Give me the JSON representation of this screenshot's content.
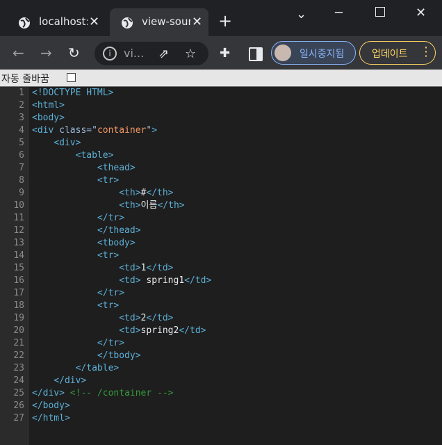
{
  "tabs": [
    {
      "title": "localhost:",
      "active": false
    },
    {
      "title": "view-sour",
      "active": true
    }
  ],
  "toolbar": {
    "url": "vi...",
    "profile_label": "일시중지됨",
    "update_label": "업데이트"
  },
  "wrap": {
    "label": "자동 줄바꿈",
    "checked": false
  },
  "colors": {
    "tag": "#5db0d7",
    "attr": "#9bbbdc",
    "value": "#f29766",
    "comment": "#35993b",
    "profile": "#8ab4f8",
    "update": "#fdd663"
  },
  "source_lines": [
    {
      "n": "1",
      "indent": "",
      "parts": [
        [
          "tag",
          "<!DOCTYPE HTML>"
        ]
      ]
    },
    {
      "n": "2",
      "indent": "",
      "parts": [
        [
          "tag",
          "<html>"
        ]
      ]
    },
    {
      "n": "3",
      "indent": "",
      "parts": [
        [
          "tag",
          "<body>"
        ]
      ]
    },
    {
      "n": "4",
      "indent": "",
      "parts": [
        [
          "tag",
          "<div "
        ],
        [
          "attr",
          "class=\""
        ],
        [
          "val",
          "container"
        ],
        [
          "attr",
          "\""
        ],
        [
          "tag",
          ">"
        ]
      ]
    },
    {
      "n": "5",
      "indent": "    ",
      "parts": [
        [
          "tag",
          "<div>"
        ]
      ]
    },
    {
      "n": "6",
      "indent": "        ",
      "parts": [
        [
          "tag",
          "<table>"
        ]
      ]
    },
    {
      "n": "7",
      "indent": "            ",
      "parts": [
        [
          "tag",
          "<thead>"
        ]
      ]
    },
    {
      "n": "8",
      "indent": "            ",
      "parts": [
        [
          "tag",
          "<tr>"
        ]
      ]
    },
    {
      "n": "9",
      "indent": "                ",
      "parts": [
        [
          "tag",
          "<th>"
        ],
        [
          "txt",
          "#"
        ],
        [
          "tag",
          "</th>"
        ]
      ]
    },
    {
      "n": "10",
      "indent": "                ",
      "parts": [
        [
          "tag",
          "<th>"
        ],
        [
          "txt",
          "이름"
        ],
        [
          "tag",
          "</th>"
        ]
      ]
    },
    {
      "n": "11",
      "indent": "            ",
      "parts": [
        [
          "tag",
          "</tr>"
        ]
      ]
    },
    {
      "n": "12",
      "indent": "            ",
      "parts": [
        [
          "tag",
          "</thead>"
        ]
      ]
    },
    {
      "n": "13",
      "indent": "            ",
      "parts": [
        [
          "tag",
          "<tbody>"
        ]
      ]
    },
    {
      "n": "14",
      "indent": "            ",
      "parts": [
        [
          "tag",
          "<tr>"
        ]
      ]
    },
    {
      "n": "15",
      "indent": "                ",
      "parts": [
        [
          "tag",
          "<td>"
        ],
        [
          "txt",
          "1"
        ],
        [
          "tag",
          "</td>"
        ]
      ]
    },
    {
      "n": "16",
      "indent": "                ",
      "parts": [
        [
          "tag",
          "<td>"
        ],
        [
          "txt",
          " spring1"
        ],
        [
          "tag",
          "</td>"
        ]
      ]
    },
    {
      "n": "17",
      "indent": "            ",
      "parts": [
        [
          "tag",
          "</tr>"
        ]
      ]
    },
    {
      "n": "18",
      "indent": "            ",
      "parts": [
        [
          "tag",
          "<tr>"
        ]
      ]
    },
    {
      "n": "19",
      "indent": "                ",
      "parts": [
        [
          "tag",
          "<td>"
        ],
        [
          "txt",
          "2"
        ],
        [
          "tag",
          "</td>"
        ]
      ]
    },
    {
      "n": "20",
      "indent": "                ",
      "parts": [
        [
          "tag",
          "<td>"
        ],
        [
          "txt",
          "spring2"
        ],
        [
          "tag",
          "</td>"
        ]
      ]
    },
    {
      "n": "21",
      "indent": "            ",
      "parts": [
        [
          "tag",
          "</tr>"
        ]
      ]
    },
    {
      "n": "22",
      "indent": "            ",
      "parts": [
        [
          "tag",
          "</tbody>"
        ]
      ]
    },
    {
      "n": "23",
      "indent": "        ",
      "parts": [
        [
          "tag",
          "</table>"
        ]
      ]
    },
    {
      "n": "24",
      "indent": "    ",
      "parts": [
        [
          "tag",
          "</div>"
        ]
      ]
    },
    {
      "n": "25",
      "indent": "",
      "parts": [
        [
          "tag",
          "</div> "
        ],
        [
          "cmt",
          "<!-- /container -->"
        ]
      ]
    },
    {
      "n": "26",
      "indent": "",
      "parts": [
        [
          "tag",
          "</body>"
        ]
      ]
    },
    {
      "n": "27",
      "indent": "",
      "parts": [
        [
          "tag",
          "</html>"
        ]
      ]
    }
  ]
}
